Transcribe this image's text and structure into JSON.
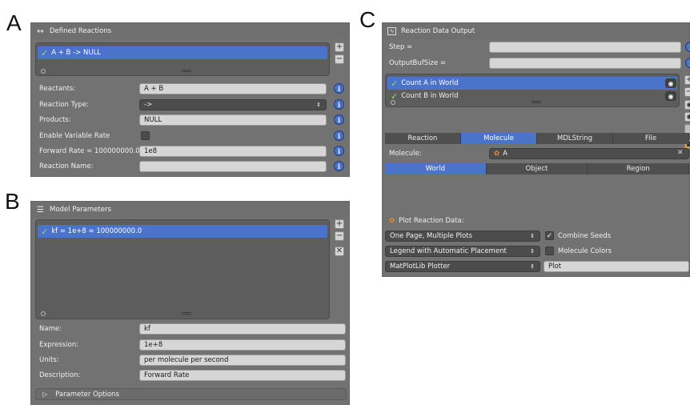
{
  "figure_labels": {
    "a": "A",
    "b": "B",
    "c": "C"
  },
  "panel_a": {
    "title": "Defined Reactions",
    "list_items": [
      {
        "label": "A + B -> NULL",
        "checked": true
      }
    ],
    "fields": {
      "reactants_label": "Reactants:",
      "reactants_value": "A + B",
      "reaction_type_label": "Reaction Type:",
      "reaction_type_value": "->",
      "products_label": "Products:",
      "products_value": "NULL",
      "variable_rate_label": "Enable Variable Rate",
      "variable_rate_checked": false,
      "forward_rate_label": "Forward Rate = 100000000.0",
      "forward_rate_value": "1e8",
      "reaction_name_label": "Reaction Name:",
      "reaction_name_value": ""
    }
  },
  "panel_b": {
    "title": "Model Parameters",
    "list_items": [
      {
        "label": "kf = 1e+8 = 100000000.0",
        "checked": true
      }
    ],
    "fields": {
      "name_label": "Name:",
      "name_value": "kf",
      "expression_label": "Expression:",
      "expression_value": "1e+8",
      "units_label": "Units:",
      "units_value": "per molecule per second",
      "description_label": "Description:",
      "description_value": "Forward Rate"
    },
    "options_label": "Parameter Options"
  },
  "panel_c": {
    "title": "Reaction Data Output",
    "step_label": "Step =",
    "step_value": "",
    "outbuf_label": "OutputBufSize =",
    "outbuf_value": "",
    "list_items": [
      {
        "label": "Count A in World",
        "checked": true
      },
      {
        "label": "Count B in World",
        "checked": true
      }
    ],
    "tabs": [
      "Reaction",
      "Molecule",
      "MDLString",
      "File"
    ],
    "active_tab": "Molecule",
    "molecule_label": "Molecule:",
    "molecule_value": "A",
    "scope_tabs": [
      "World",
      "Object",
      "Region"
    ],
    "active_scope": "World",
    "plot_label": "Plot Reaction Data:",
    "page_layout": "One Page, Multiple Plots",
    "combine_seeds_label": "Combine Seeds",
    "combine_seeds_checked": true,
    "legend": "Legend with Automatic Placement",
    "molecule_colors_label": "Molecule Colors",
    "molecule_colors_checked": false,
    "plotter": "MatPlotLib Plotter",
    "plot_button": "Plot"
  },
  "colors": {
    "selection": "#4a73c9",
    "panel_bg": "#727272",
    "check": "#8fe06a",
    "info": "#4a6fc4"
  }
}
